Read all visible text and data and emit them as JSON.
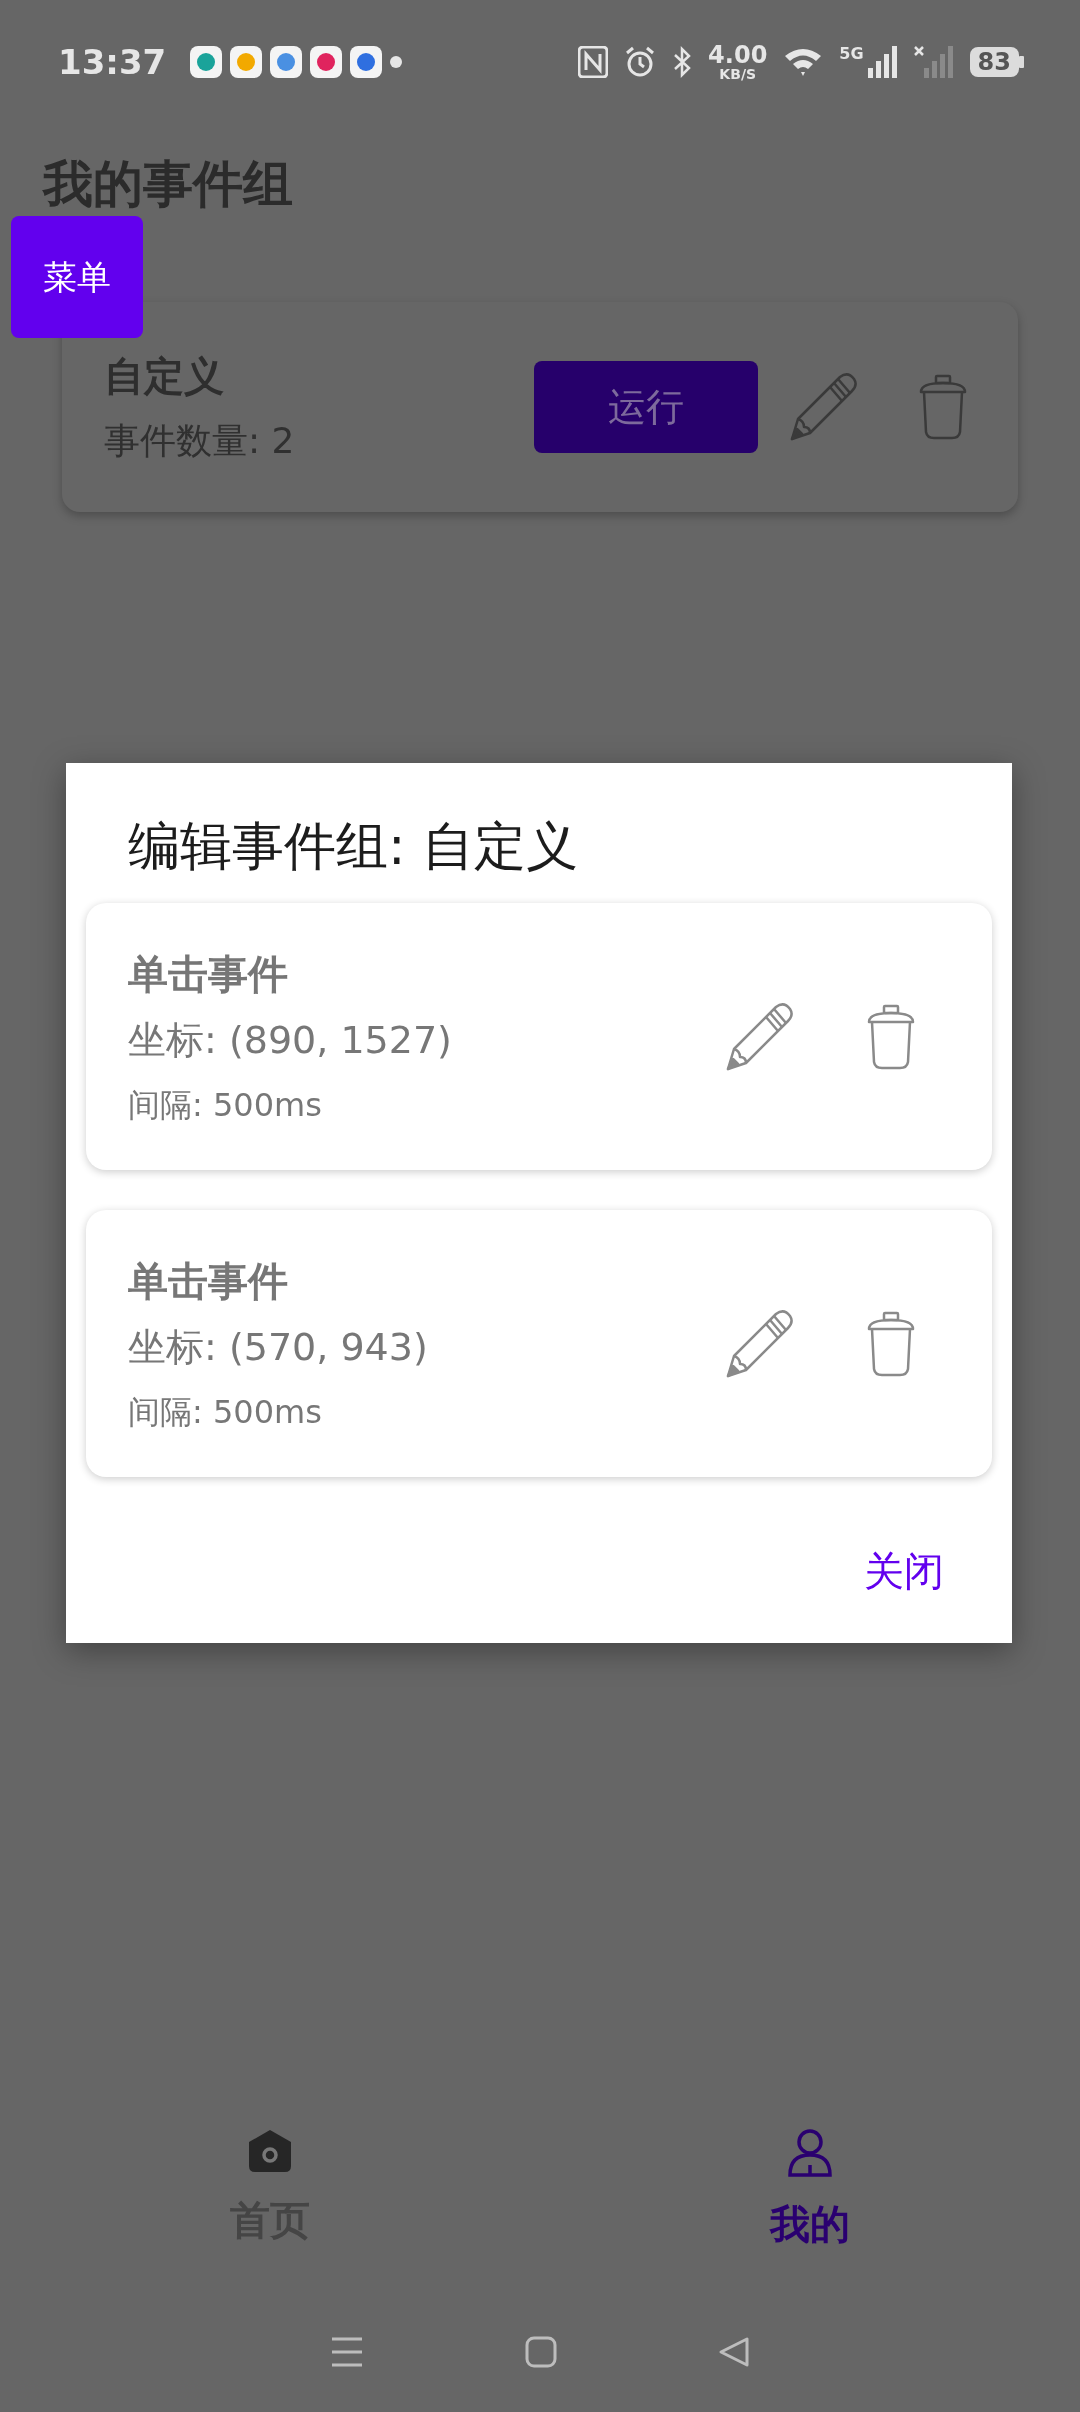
{
  "status_bar": {
    "time": "13:37",
    "speed": "4.00",
    "speed_unit": "KB/S",
    "network": "5G",
    "battery": "83"
  },
  "page": {
    "title": "我的事件组",
    "menu_button": "菜单",
    "groups": [
      {
        "name": "自定义",
        "count": "事件数量: 2",
        "run_button": "运行"
      }
    ]
  },
  "dialog": {
    "title": "编辑事件组: 自定义",
    "events": [
      {
        "title": "单击事件",
        "coords": "坐标: (890, 1527)",
        "interval": "间隔: 500ms"
      },
      {
        "title": "单击事件",
        "coords": "坐标: (570, 943)",
        "interval": "间隔: 500ms"
      }
    ],
    "close_button": "关闭"
  },
  "bottom_nav": [
    {
      "kind": "home",
      "label": "首页",
      "selected": false
    },
    {
      "kind": "profile",
      "label": "我的",
      "selected": true
    }
  ]
}
